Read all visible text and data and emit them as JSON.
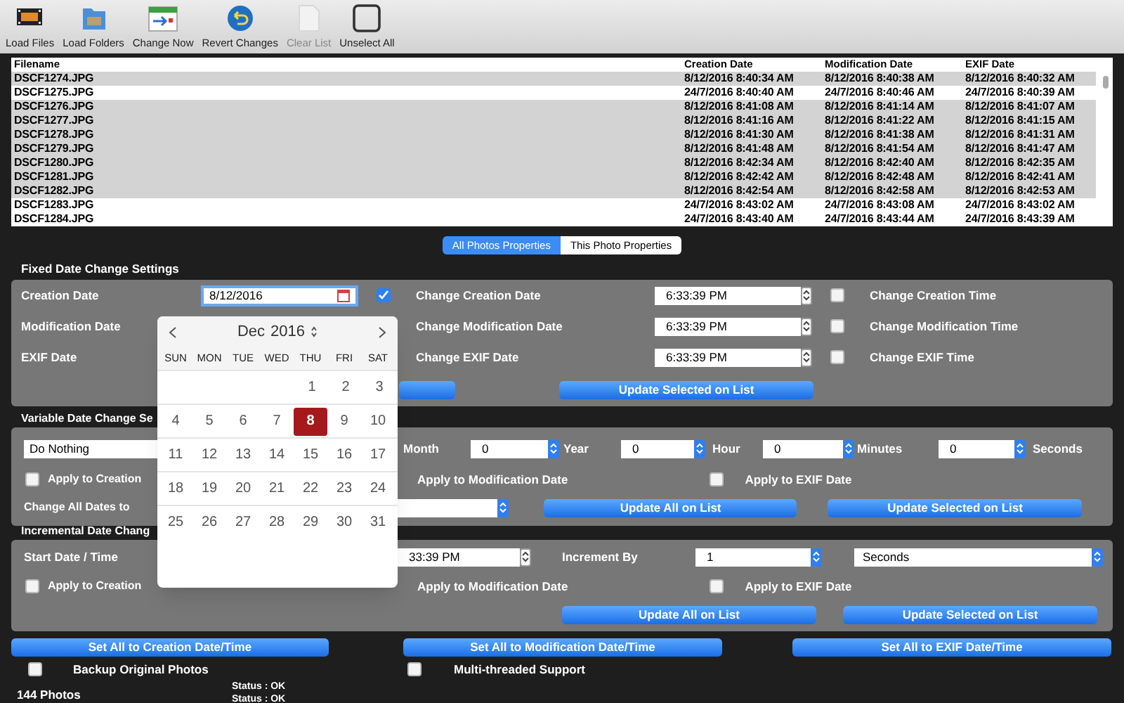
{
  "toolbar": [
    {
      "label": "Load Files"
    },
    {
      "label": "Load Folders"
    },
    {
      "label": "Change Now"
    },
    {
      "label": "Revert Changes"
    },
    {
      "label": "Clear List"
    },
    {
      "label": "Unselect All"
    }
  ],
  "file_table": {
    "columns": [
      "Filename",
      "Creation Date",
      "Modification Date",
      "EXIF Date"
    ],
    "rows": [
      {
        "cells": [
          "DSCF1274.JPG",
          "8/12/2016 8:40:34 AM",
          "8/12/2016 8:40:38 AM",
          "8/12/2016 8:40:32 AM"
        ],
        "selected": true
      },
      {
        "cells": [
          "DSCF1275.JPG",
          "24/7/2016 8:40:40 AM",
          "24/7/2016 8:40:46 AM",
          "24/7/2016 8:40:39 AM"
        ],
        "selected": false
      },
      {
        "cells": [
          "DSCF1276.JPG",
          "8/12/2016 8:41:08 AM",
          "8/12/2016 8:41:14 AM",
          "8/12/2016 8:41:07 AM"
        ],
        "selected": true
      },
      {
        "cells": [
          "DSCF1277.JPG",
          "8/12/2016 8:41:16 AM",
          "8/12/2016 8:41:22 AM",
          "8/12/2016 8:41:15 AM"
        ],
        "selected": true
      },
      {
        "cells": [
          "DSCF1278.JPG",
          "8/12/2016 8:41:30 AM",
          "8/12/2016 8:41:38 AM",
          "8/12/2016 8:41:31 AM"
        ],
        "selected": true
      },
      {
        "cells": [
          "DSCF1279.JPG",
          "8/12/2016 8:41:48 AM",
          "8/12/2016 8:41:54 AM",
          "8/12/2016 8:41:47 AM"
        ],
        "selected": true
      },
      {
        "cells": [
          "DSCF1280.JPG",
          "8/12/2016 8:42:34 AM",
          "8/12/2016 8:42:40 AM",
          "8/12/2016 8:42:35 AM"
        ],
        "selected": true
      },
      {
        "cells": [
          "DSCF1281.JPG",
          "8/12/2016 8:42:42 AM",
          "8/12/2016 8:42:48 AM",
          "8/12/2016 8:42:41 AM"
        ],
        "selected": true
      },
      {
        "cells": [
          "DSCF1282.JPG",
          "8/12/2016 8:42:54 AM",
          "8/12/2016 8:42:58 AM",
          "8/12/2016 8:42:53 AM"
        ],
        "selected": true
      },
      {
        "cells": [
          "DSCF1283.JPG",
          "24/7/2016 8:43:02 AM",
          "24/7/2016 8:43:08 AM",
          "24/7/2016 8:43:02 AM"
        ],
        "selected": false
      },
      {
        "cells": [
          "DSCF1284.JPG",
          "24/7/2016 8:43:40 AM",
          "24/7/2016 8:43:44 AM",
          "24/7/2016 8:43:39 AM"
        ],
        "selected": false
      }
    ]
  },
  "view_tabs": [
    {
      "label": "All Photos Properties",
      "selected": true
    },
    {
      "label": "This Photo Properties",
      "selected": false
    }
  ],
  "fixed_settings": {
    "title": "Fixed Date Change Settings",
    "rows": [
      {
        "label": "Creation Date",
        "date": "8/12/2016",
        "date_checked": true,
        "change_date_label": "Change Creation Date",
        "time": "6:33:39 PM",
        "time_checked": false,
        "change_time_label": "Change Creation Time"
      },
      {
        "label": "Modification Date",
        "change_date_label": "Change Modification Date",
        "time": "6:33:39 PM",
        "time_checked": false,
        "change_time_label": "Change Modification Time"
      },
      {
        "label": "EXIF Date",
        "change_date_label": "Change EXIF Date",
        "time": "6:33:39 PM",
        "time_checked": false,
        "change_time_label": "Change EXIF Time"
      }
    ],
    "update_button": "Update Selected on List"
  },
  "variable_settings": {
    "title": "Variable Date Change Se",
    "mode": "Do Nothing",
    "units": [
      {
        "label": "Month",
        "value": "0"
      },
      {
        "label": "Year",
        "value": "0"
      },
      {
        "label": "Hour",
        "value": "0"
      },
      {
        "label": "Minutes",
        "value": "0"
      },
      {
        "label": "Seconds"
      }
    ],
    "apply": [
      {
        "label": "Apply to Creation",
        "checked": false
      },
      {
        "label": "Apply to Modification Date"
      },
      {
        "label": "Apply to EXIF Date",
        "checked": false
      }
    ],
    "change_all_label": "Change All Dates to",
    "buttons": [
      "Update All on List",
      "Update Selected on List"
    ]
  },
  "incremental_settings": {
    "title": "Incremental Date Chang",
    "start_label": "Start Date / Time",
    "start_time": "33:39 PM",
    "increment_label": "Increment By",
    "increment": "1",
    "unit": "Seconds",
    "apply": [
      {
        "label": "Apply to Creation",
        "checked": false
      },
      {
        "label": "Apply to Modification Date"
      },
      {
        "label": "Apply to EXIF Date",
        "checked": false
      }
    ],
    "buttons": [
      "Update All on List",
      "Update Selected on List"
    ]
  },
  "set_all_buttons": [
    "Set All to Creation Date/Time",
    "Set All to Modification Date/Time",
    "Set All to EXIF Date/Time"
  ],
  "options": [
    {
      "label": "Backup Original Photos",
      "checked": false
    },
    {
      "label": "Multi-threaded Support",
      "checked": false
    }
  ],
  "photo_count": "144 Photos",
  "statuses": [
    "Status : OK",
    "Status : OK"
  ],
  "calendar": {
    "month": "Dec",
    "year": "2016",
    "weekdays": [
      "SUN",
      "MON",
      "TUE",
      "WED",
      "THU",
      "FRI",
      "SAT"
    ],
    "weeks": [
      [
        {
          "day": "1",
          "selected": false
        },
        {
          "day": "2",
          "selected": false
        },
        {
          "day": "3",
          "selected": false
        }
      ],
      [
        {
          "day": "4",
          "selected": false
        },
        {
          "day": "5",
          "selected": false
        },
        {
          "day": "6",
          "selected": false
        },
        {
          "day": "7",
          "selected": false
        },
        {
          "day": "8",
          "selected": true
        },
        {
          "day": "9",
          "selected": false
        },
        {
          "day": "10",
          "selected": false
        }
      ],
      [
        {
          "day": "11",
          "selected": false
        },
        {
          "day": "12",
          "selected": false
        },
        {
          "day": "13",
          "selected": false
        },
        {
          "day": "14",
          "selected": false
        },
        {
          "day": "15",
          "selected": false
        },
        {
          "day": "16",
          "selected": false
        },
        {
          "day": "17",
          "selected": false
        }
      ],
      [
        {
          "day": "18",
          "selected": false
        },
        {
          "day": "19",
          "selected": false
        },
        {
          "day": "20",
          "selected": false
        },
        {
          "day": "21",
          "selected": false
        },
        {
          "day": "22",
          "selected": false
        },
        {
          "day": "23",
          "selected": false
        },
        {
          "day": "24",
          "selected": false
        }
      ],
      [
        {
          "day": "25",
          "selected": false
        },
        {
          "day": "26",
          "selected": false
        },
        {
          "day": "27",
          "selected": false
        },
        {
          "day": "28",
          "selected": false
        },
        {
          "day": "29",
          "selected": false
        },
        {
          "day": "30",
          "selected": false
        },
        {
          "day": "31",
          "selected": false
        }
      ]
    ]
  }
}
